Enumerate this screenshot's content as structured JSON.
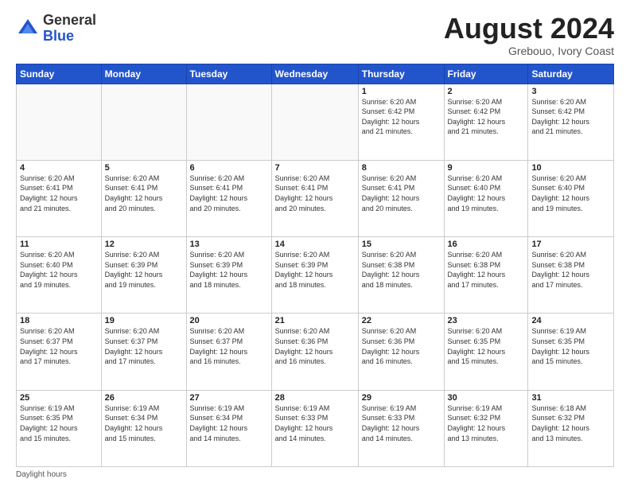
{
  "header": {
    "logo_general": "General",
    "logo_blue": "Blue",
    "month_title": "August 2024",
    "location": "Grebouo, Ivory Coast"
  },
  "days_of_week": [
    "Sunday",
    "Monday",
    "Tuesday",
    "Wednesday",
    "Thursday",
    "Friday",
    "Saturday"
  ],
  "weeks": [
    [
      {
        "day": "",
        "info": ""
      },
      {
        "day": "",
        "info": ""
      },
      {
        "day": "",
        "info": ""
      },
      {
        "day": "",
        "info": ""
      },
      {
        "day": "1",
        "info": "Sunrise: 6:20 AM\nSunset: 6:42 PM\nDaylight: 12 hours\nand 21 minutes."
      },
      {
        "day": "2",
        "info": "Sunrise: 6:20 AM\nSunset: 6:42 PM\nDaylight: 12 hours\nand 21 minutes."
      },
      {
        "day": "3",
        "info": "Sunrise: 6:20 AM\nSunset: 6:42 PM\nDaylight: 12 hours\nand 21 minutes."
      }
    ],
    [
      {
        "day": "4",
        "info": "Sunrise: 6:20 AM\nSunset: 6:41 PM\nDaylight: 12 hours\nand 21 minutes."
      },
      {
        "day": "5",
        "info": "Sunrise: 6:20 AM\nSunset: 6:41 PM\nDaylight: 12 hours\nand 20 minutes."
      },
      {
        "day": "6",
        "info": "Sunrise: 6:20 AM\nSunset: 6:41 PM\nDaylight: 12 hours\nand 20 minutes."
      },
      {
        "day": "7",
        "info": "Sunrise: 6:20 AM\nSunset: 6:41 PM\nDaylight: 12 hours\nand 20 minutes."
      },
      {
        "day": "8",
        "info": "Sunrise: 6:20 AM\nSunset: 6:41 PM\nDaylight: 12 hours\nand 20 minutes."
      },
      {
        "day": "9",
        "info": "Sunrise: 6:20 AM\nSunset: 6:40 PM\nDaylight: 12 hours\nand 19 minutes."
      },
      {
        "day": "10",
        "info": "Sunrise: 6:20 AM\nSunset: 6:40 PM\nDaylight: 12 hours\nand 19 minutes."
      }
    ],
    [
      {
        "day": "11",
        "info": "Sunrise: 6:20 AM\nSunset: 6:40 PM\nDaylight: 12 hours\nand 19 minutes."
      },
      {
        "day": "12",
        "info": "Sunrise: 6:20 AM\nSunset: 6:39 PM\nDaylight: 12 hours\nand 19 minutes."
      },
      {
        "day": "13",
        "info": "Sunrise: 6:20 AM\nSunset: 6:39 PM\nDaylight: 12 hours\nand 18 minutes."
      },
      {
        "day": "14",
        "info": "Sunrise: 6:20 AM\nSunset: 6:39 PM\nDaylight: 12 hours\nand 18 minutes."
      },
      {
        "day": "15",
        "info": "Sunrise: 6:20 AM\nSunset: 6:38 PM\nDaylight: 12 hours\nand 18 minutes."
      },
      {
        "day": "16",
        "info": "Sunrise: 6:20 AM\nSunset: 6:38 PM\nDaylight: 12 hours\nand 17 minutes."
      },
      {
        "day": "17",
        "info": "Sunrise: 6:20 AM\nSunset: 6:38 PM\nDaylight: 12 hours\nand 17 minutes."
      }
    ],
    [
      {
        "day": "18",
        "info": "Sunrise: 6:20 AM\nSunset: 6:37 PM\nDaylight: 12 hours\nand 17 minutes."
      },
      {
        "day": "19",
        "info": "Sunrise: 6:20 AM\nSunset: 6:37 PM\nDaylight: 12 hours\nand 17 minutes."
      },
      {
        "day": "20",
        "info": "Sunrise: 6:20 AM\nSunset: 6:37 PM\nDaylight: 12 hours\nand 16 minutes."
      },
      {
        "day": "21",
        "info": "Sunrise: 6:20 AM\nSunset: 6:36 PM\nDaylight: 12 hours\nand 16 minutes."
      },
      {
        "day": "22",
        "info": "Sunrise: 6:20 AM\nSunset: 6:36 PM\nDaylight: 12 hours\nand 16 minutes."
      },
      {
        "day": "23",
        "info": "Sunrise: 6:20 AM\nSunset: 6:35 PM\nDaylight: 12 hours\nand 15 minutes."
      },
      {
        "day": "24",
        "info": "Sunrise: 6:19 AM\nSunset: 6:35 PM\nDaylight: 12 hours\nand 15 minutes."
      }
    ],
    [
      {
        "day": "25",
        "info": "Sunrise: 6:19 AM\nSunset: 6:35 PM\nDaylight: 12 hours\nand 15 minutes."
      },
      {
        "day": "26",
        "info": "Sunrise: 6:19 AM\nSunset: 6:34 PM\nDaylight: 12 hours\nand 15 minutes."
      },
      {
        "day": "27",
        "info": "Sunrise: 6:19 AM\nSunset: 6:34 PM\nDaylight: 12 hours\nand 14 minutes."
      },
      {
        "day": "28",
        "info": "Sunrise: 6:19 AM\nSunset: 6:33 PM\nDaylight: 12 hours\nand 14 minutes."
      },
      {
        "day": "29",
        "info": "Sunrise: 6:19 AM\nSunset: 6:33 PM\nDaylight: 12 hours\nand 14 minutes."
      },
      {
        "day": "30",
        "info": "Sunrise: 6:19 AM\nSunset: 6:32 PM\nDaylight: 12 hours\nand 13 minutes."
      },
      {
        "day": "31",
        "info": "Sunrise: 6:18 AM\nSunset: 6:32 PM\nDaylight: 12 hours\nand 13 minutes."
      }
    ]
  ],
  "footer": {
    "daylight_label": "Daylight hours"
  }
}
